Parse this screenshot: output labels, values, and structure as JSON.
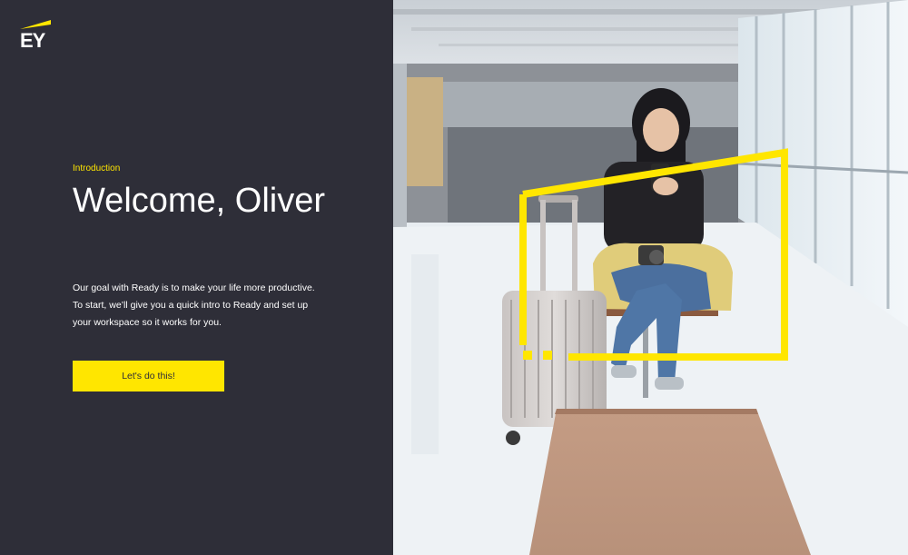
{
  "brand": {
    "logo_text": "EY",
    "accent": "#ffe600",
    "panel_bg": "#2e2e38"
  },
  "intro": {
    "label": "Introduction",
    "title": "Welcome, Oliver",
    "body_lines": [
      "Our goal with Ready is to make your life more productive.",
      "To start, we’ll give you a quick intro to Ready and set up",
      "your workspace so it works for you."
    ],
    "cta_label": "Let's do this!"
  }
}
